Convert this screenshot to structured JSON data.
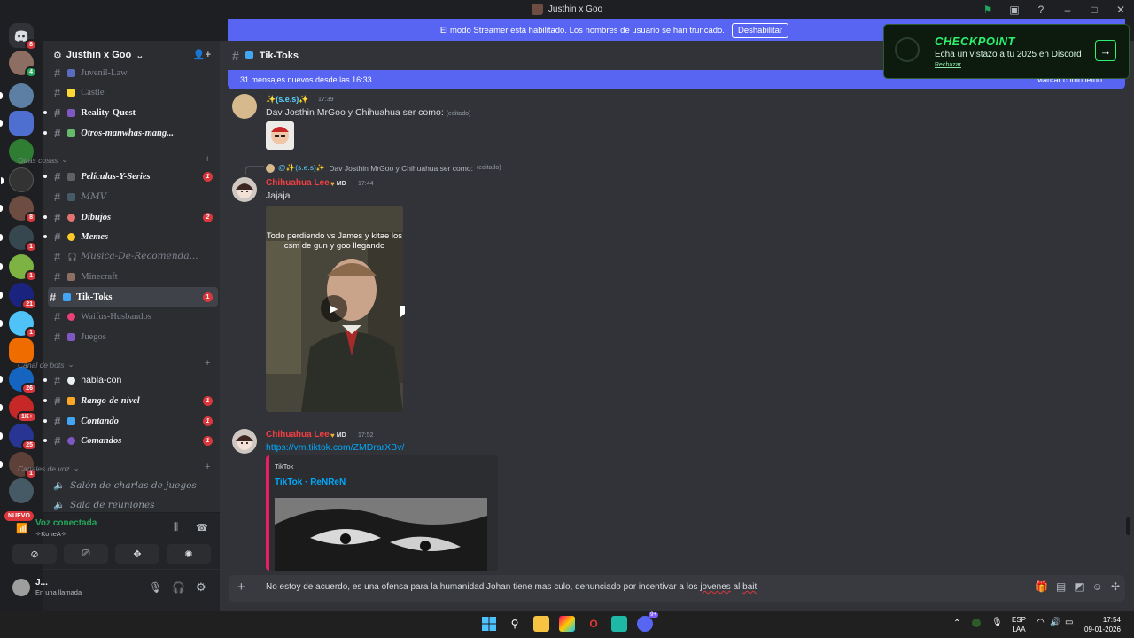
{
  "window": {
    "title": "Justhin x Goo"
  },
  "streamer_banner": {
    "text": "El modo Streamer está habilitado. Los nombres de usuario se han truncado.",
    "button": "Deshabilitar"
  },
  "server_rail": {
    "badges": [
      "8",
      "4",
      "8",
      "1",
      "1",
      "21",
      "1",
      "26",
      "1K+",
      "25",
      "1"
    ],
    "new_label": "NUEVO"
  },
  "guild": {
    "name": "Justhin x Goo"
  },
  "channels": [
    {
      "label": "Juvenil-Law",
      "state": "muted"
    },
    {
      "label": "Castle",
      "state": "muted"
    },
    {
      "label": "Reality-Quest",
      "state": "bold"
    },
    {
      "label": "Otros-manwhas-mang...",
      "state": "unread"
    },
    {
      "label": "Películas-Y-Series",
      "state": "unread",
      "badge": "1"
    },
    {
      "label": "MMV",
      "state": "muted"
    },
    {
      "label": "Dibujos",
      "state": "unread",
      "badge": "2"
    },
    {
      "label": "Memes",
      "state": "unread"
    },
    {
      "label": "Musica-De-Recomenda...",
      "state": "muted"
    },
    {
      "label": "Minecraft",
      "state": "muted"
    },
    {
      "label": "Tik-Toks",
      "state": "active",
      "badge": "1"
    },
    {
      "label": "Waifus-Husbandos",
      "state": "muted"
    },
    {
      "label": "Juegos",
      "state": "muted"
    },
    {
      "label": "habla-con",
      "state": "plain"
    },
    {
      "label": "Rango-de-nivel",
      "state": "unread",
      "badge": "1"
    },
    {
      "label": "Contando",
      "state": "unread",
      "badge": "1"
    },
    {
      "label": "Comandos",
      "state": "unread",
      "badge": "1"
    }
  ],
  "categories": {
    "otras": "Otras cosas",
    "bots": "Canal de bots",
    "voz": "Canales de voz"
  },
  "voice_channels": [
    "Salón de charlas de juegos",
    "Sala de reuniones"
  ],
  "voice_panel": {
    "title": "Voz conectada",
    "subtitle": "✧KoneA✧"
  },
  "user_panel": {
    "name": "J...",
    "status": "En una llamada"
  },
  "channel_header": {
    "name": "Tik-Toks"
  },
  "new_messages": {
    "text": "31 mensajes nuevos desde las 16:33",
    "mark": "Marcar como leído"
  },
  "checkpoint": {
    "title": "CHECKPOINT",
    "subtitle": "Echa un vistazo a tu 2025 en Discord",
    "dismiss": "Rechazar"
  },
  "messages": [
    {
      "author": "✨(s.e.s)✨",
      "time": "17:39",
      "text": "Dav Josthin MrGoo y Chihuahua ser como:",
      "edited": "(editado)"
    },
    {
      "reply_author": "@✨(s.e.s)✨",
      "reply_text": "Dav Josthin MrGoo y Chihuahua ser como:",
      "reply_edited": "(editado)",
      "author": "Chihuahua Lee",
      "role": "MD",
      "time": "17:44",
      "text": "Jajaja",
      "video_caption": "Todo perdiendo vs James y kitae los csm de gun y goo llegando"
    },
    {
      "author": "Chihuahua Lee",
      "role": "MD",
      "time": "17:52",
      "link": "https://vm.tiktok.com/ZMDrarXBv/",
      "embed_provider": "TikTok",
      "embed_title": "TikTok · ReNReN"
    }
  ],
  "composer": {
    "text_before": "No estoy de acuerdo, es una ofensa para la humanidad Johan tiene mas culo, denunciado por incentivar a los ",
    "text_err1": "jovenes",
    "text_mid": " al ",
    "text_err2": "bait"
  },
  "taskbar": {
    "lang1": "ESP",
    "lang2": "LAA",
    "time": "17:54",
    "date": "09-01-2026",
    "discord_badge": "9+"
  },
  "colors": {
    "accent": "#5865f2",
    "danger": "#da373c",
    "online": "#23a55a",
    "username": "#f23f43",
    "link": "#00a8fc"
  }
}
